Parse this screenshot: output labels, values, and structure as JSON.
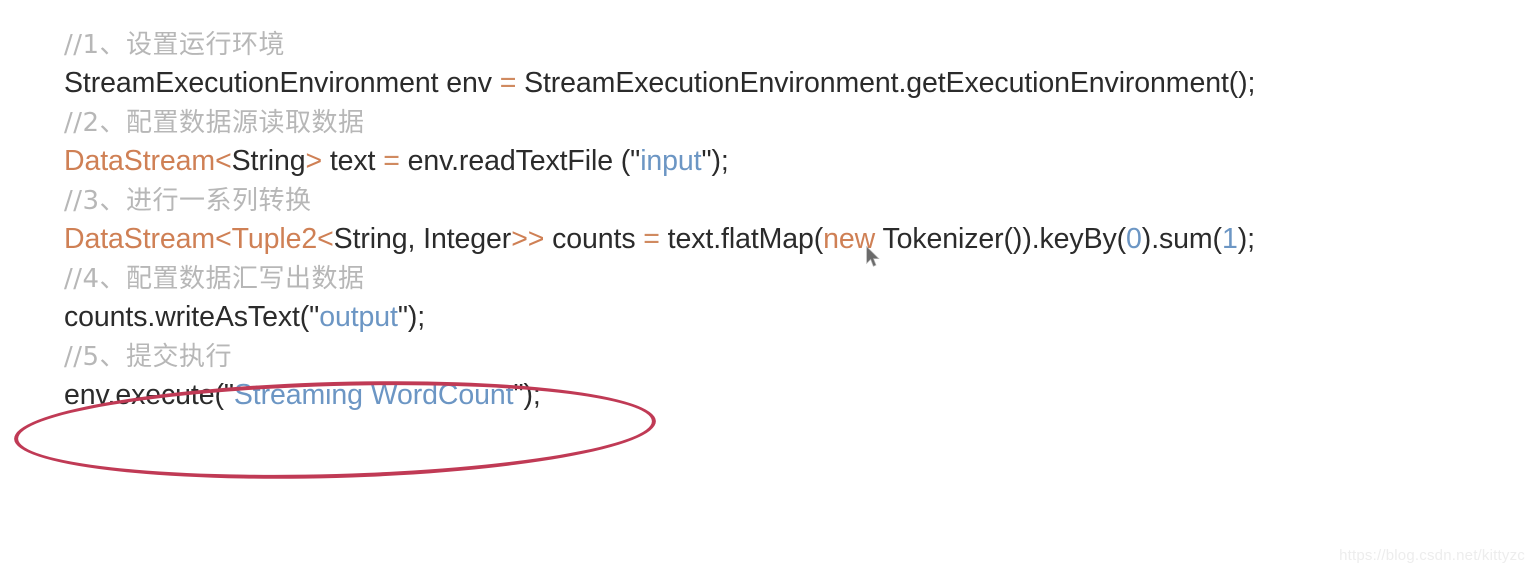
{
  "slide": {
    "background_color": "#ffffff",
    "title": "Flink Streaming WordCount code sample"
  },
  "theme": {
    "comment_color": "#b7b7b7",
    "code_color": "#2b2b2b",
    "keyword_color": "#cf8055",
    "string_color": "#6c96c4",
    "number_color": "#6c96c4",
    "operator_color": "#d08a60",
    "annotation_color": "#c03a55",
    "watermark_color": "#ededed"
  },
  "code": {
    "line1_comment": "//1、设置运行环境",
    "line2": {
      "part_a": "StreamExecutionEnvironment env ",
      "equals": "=",
      "part_b": " StreamExecutionEnvironment.getExecutionEnvironment();"
    },
    "line3_comment": "//2、配置数据源读取数据",
    "line4": {
      "type": "DataStream",
      "lt": "<",
      "generic": "String",
      "gt": ">",
      "var": " text ",
      "equals": "=",
      "call": " env.readTextFile (\"",
      "string": "input",
      "tail": "\");"
    },
    "line5_comment": "//3、进行一系列转换",
    "line6": {
      "type": "DataStream",
      "lt1": "<",
      "tuple": "Tuple2",
      "lt2": "<",
      "generic": "String, Integer",
      "gt2": ">>",
      "var": " counts ",
      "equals": "=",
      "call": " text.flatMap(",
      "keyword_new": "new",
      "mid": " Tokenizer()).keyBy(",
      "num0": "0",
      "mid2": ").sum(",
      "num1": "1",
      "tail": ");"
    },
    "line7_comment": "//4、配置数据汇写出数据",
    "line8": {
      "part_a": "counts.writeAsText(\"",
      "string": "output",
      "tail": "\");"
    },
    "line9_comment": "//5、提交执行",
    "line10": {
      "part_a": "env.execute(\"",
      "string": "Streaming WordCount",
      "tail": "\");"
    }
  },
  "annotation": {
    "shape": "red-ellipse",
    "target": "env.execute(\"Streaming WordCount\");"
  },
  "watermark": {
    "text": "https://blog.csdn.net/kittyzc"
  }
}
